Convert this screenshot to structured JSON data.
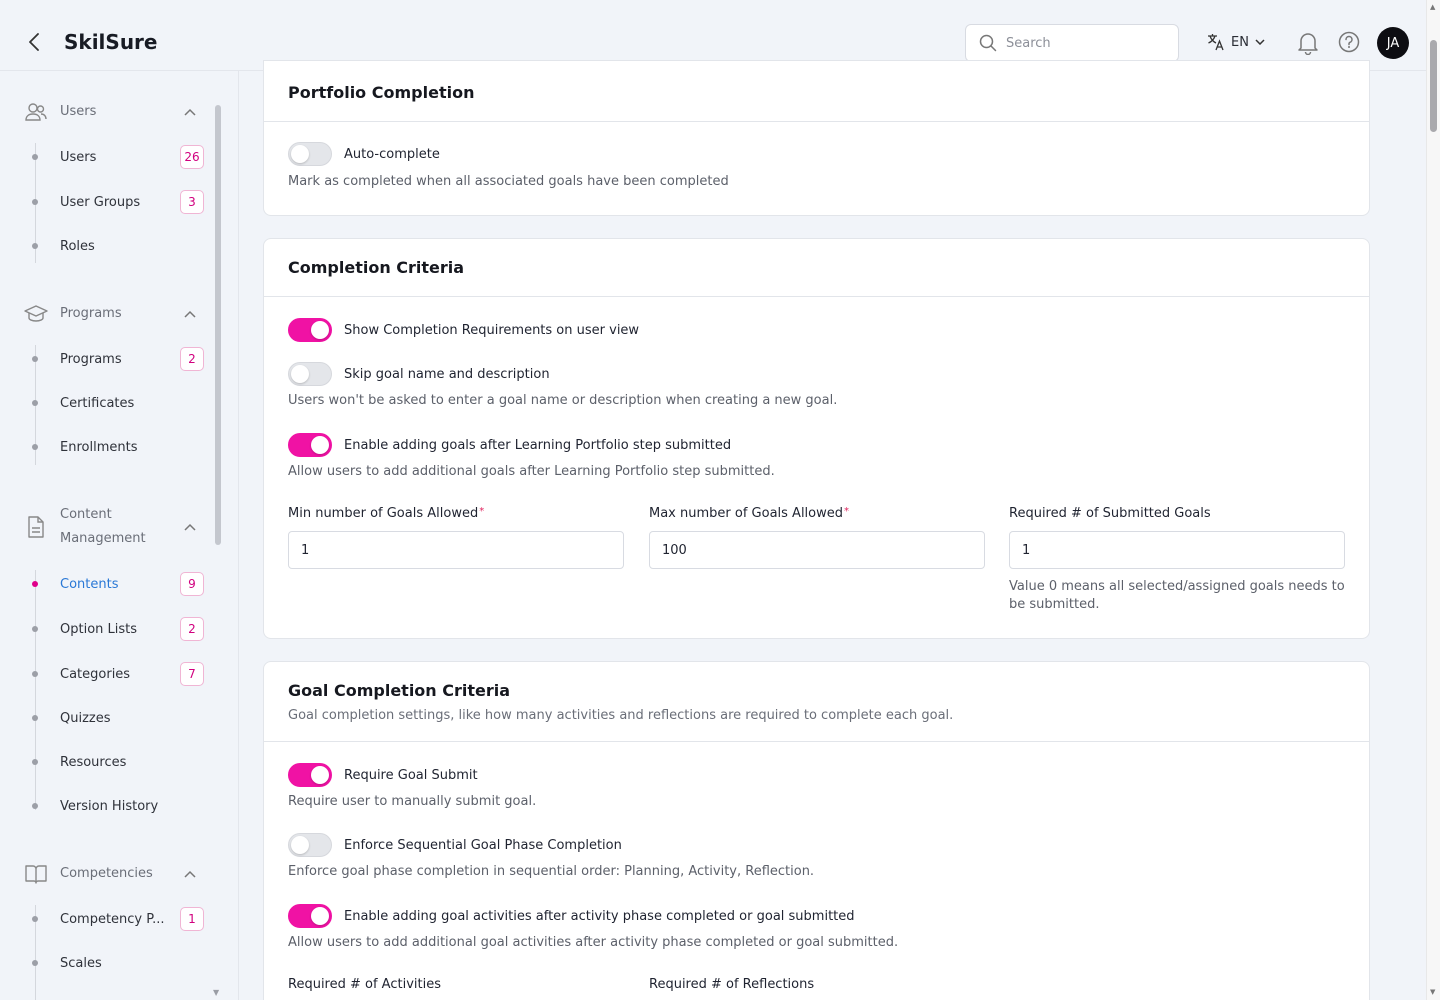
{
  "header": {
    "app_title": "SkilSure",
    "search_placeholder": "Search",
    "language": "EN",
    "avatar_initials": "JA"
  },
  "sidebar": {
    "groups": [
      {
        "label": "Users",
        "items": [
          {
            "label": "Users",
            "badge": "26"
          },
          {
            "label": "User Groups",
            "badge": "3"
          },
          {
            "label": "Roles",
            "badge": ""
          }
        ]
      },
      {
        "label": "Programs",
        "items": [
          {
            "label": "Programs",
            "badge": "2"
          },
          {
            "label": "Certificates",
            "badge": ""
          },
          {
            "label": "Enrollments",
            "badge": ""
          }
        ]
      },
      {
        "label": "Content Management",
        "items": [
          {
            "label": "Contents",
            "badge": "9",
            "active": true
          },
          {
            "label": "Option Lists",
            "badge": "2"
          },
          {
            "label": "Categories",
            "badge": "7"
          },
          {
            "label": "Quizzes",
            "badge": ""
          },
          {
            "label": "Resources",
            "badge": ""
          },
          {
            "label": "Version History",
            "badge": ""
          }
        ]
      },
      {
        "label": "Competencies",
        "items": [
          {
            "label": "Competency P...",
            "badge": "1"
          },
          {
            "label": "Scales",
            "badge": ""
          }
        ]
      }
    ]
  },
  "portfolio": {
    "title": "Portfolio Completion",
    "autocomplete_label": "Auto-complete",
    "autocomplete_on": false,
    "autocomplete_help": "Mark as completed when all associated goals have been completed"
  },
  "completion": {
    "title": "Completion Criteria",
    "show_requirements_label": "Show Completion Requirements on user view",
    "show_requirements_on": true,
    "skip_goal_label": "Skip goal name and description",
    "skip_goal_on": false,
    "skip_goal_help": "Users won't be asked to enter a goal name or description when creating a new goal.",
    "enable_goals_label": "Enable adding goals after Learning Portfolio step submitted",
    "enable_goals_on": true,
    "enable_goals_help": "Allow users to add additional goals after Learning Portfolio step submitted.",
    "min_goals_label": "Min number of Goals Allowed",
    "min_goals_value": "1",
    "max_goals_label": "Max number of Goals Allowed",
    "max_goals_value": "100",
    "required_submitted_label": "Required # of Submitted Goals",
    "required_submitted_value": "1",
    "required_submitted_help": "Value 0 means all selected/assigned goals needs to be submitted.",
    "required_marker": "*"
  },
  "goal_completion": {
    "title": "Goal Completion Criteria",
    "subtitle": "Goal completion settings, like how many activities and reflections are required to complete each goal.",
    "require_submit_label": "Require Goal Submit",
    "require_submit_on": true,
    "require_submit_help": "Require user to manually submit goal.",
    "sequential_label": "Enforce Sequential Goal Phase Completion",
    "sequential_on": false,
    "sequential_help": "Enforce goal phase completion in sequential order: Planning, Activity, Reflection.",
    "enable_activities_label": "Enable adding goal activities after activity phase completed or goal submitted",
    "enable_activities_on": true,
    "enable_activities_help": "Allow users to add additional goal activities after activity phase completed or goal submitted.",
    "required_activities_label": "Required # of Activities",
    "required_reflections_label": "Required # of Reflections"
  },
  "colors": {
    "accent": "#f012a4",
    "badge_text": "#d1007f",
    "active_link": "#2a78d6"
  }
}
